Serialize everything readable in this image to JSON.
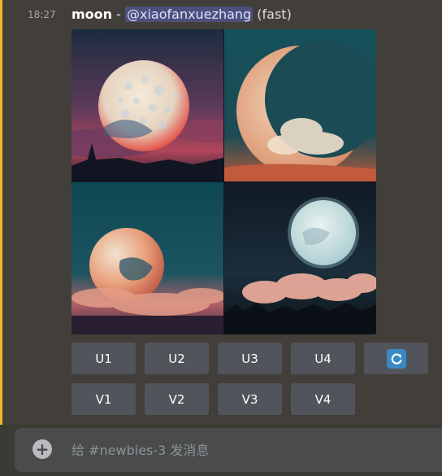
{
  "message": {
    "timestamp": "18:27",
    "prompt_text": "moon",
    "separator": " - ",
    "mention": "@xiaofanxuezhang",
    "speed_tag": " (fast)",
    "image_alt": "moon"
  },
  "buttons": {
    "upscale": [
      "U1",
      "U2",
      "U3",
      "U4"
    ],
    "variation": [
      "V1",
      "V2",
      "V3",
      "V4"
    ],
    "reroll_icon": "refresh-icon"
  },
  "composer": {
    "placeholder": "给 #newbies-3 发消息",
    "add_icon": "plus-circle-icon"
  },
  "colors": {
    "mention_bg": "#4d4f7d",
    "button_bg": "#51545b",
    "accent_bar": "#f0b232",
    "reroll_blue": "#3b88c3"
  }
}
